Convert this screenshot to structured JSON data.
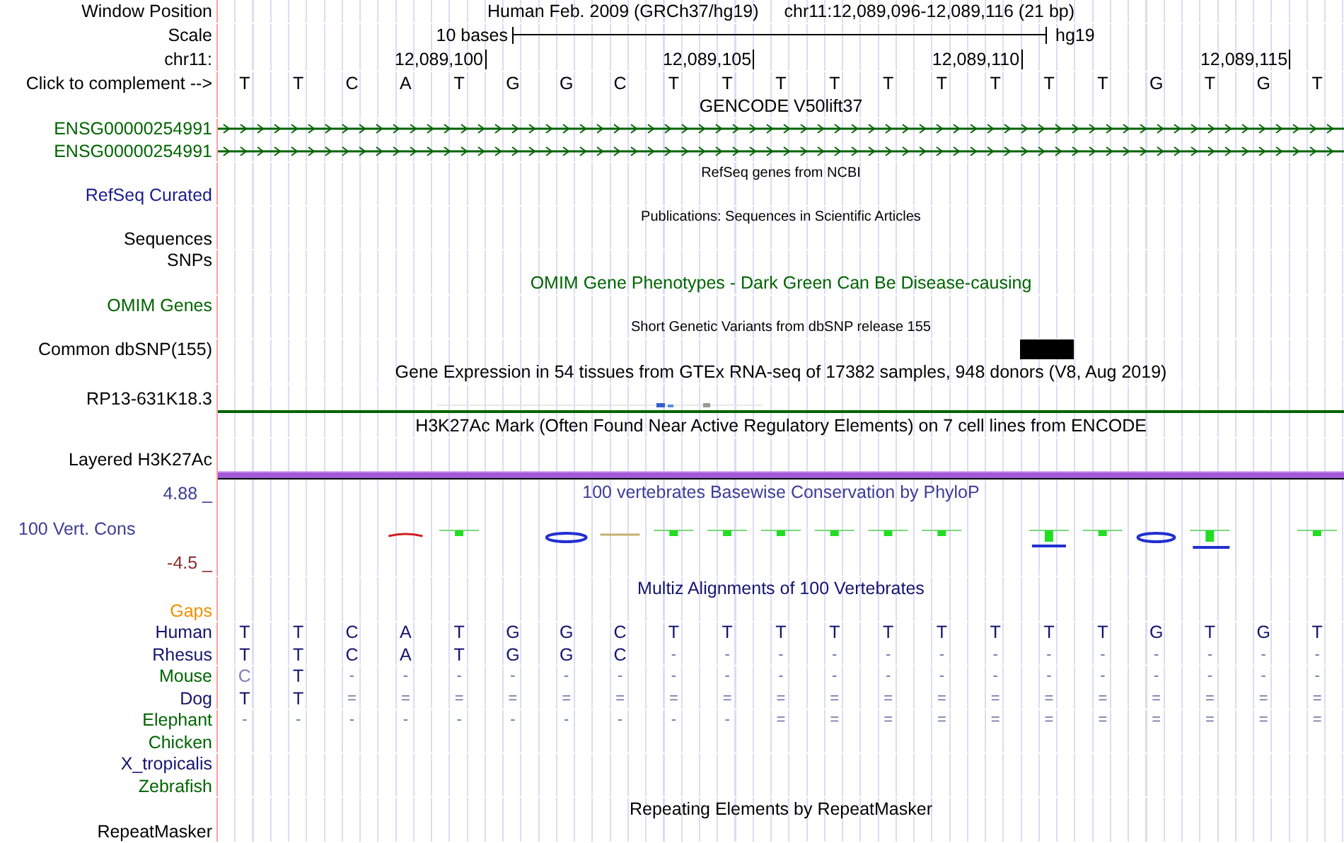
{
  "header": {
    "label": "Window Position",
    "assembly": "Human Feb. 2009 (GRCh37/hg19)",
    "position": "chr11:12,089,096-12,089,116 (21 bp)"
  },
  "scale": {
    "label": "Scale",
    "length": "10 bases",
    "assembly": "hg19"
  },
  "ruler": {
    "label": "chr11:",
    "ticks": [
      "12,089,100",
      "12,089,105",
      "12,089,110",
      "12,089,115"
    ]
  },
  "sequence": {
    "label": "Click to complement -->",
    "bases": [
      "T",
      "T",
      "C",
      "A",
      "T",
      "G",
      "G",
      "C",
      "T",
      "T",
      "T",
      "T",
      "T",
      "T",
      "T",
      "T",
      "T",
      "G",
      "T",
      "G",
      "T"
    ]
  },
  "rows": [
    {
      "kind": "title",
      "text": "GENCODE V50lift37",
      "color": "#000000"
    },
    {
      "kind": "gene",
      "label": "ENSG00000254991",
      "color": "#006400"
    },
    {
      "kind": "gene",
      "label": "ENSG00000254991",
      "color": "#006400"
    },
    {
      "kind": "caption",
      "text": "RefSeq genes from NCBI"
    },
    {
      "kind": "label",
      "label": "RefSeq Curated",
      "color": "#1a1a8c"
    },
    {
      "kind": "caption",
      "text": "Publications: Sequences in Scientific Articles"
    },
    {
      "kind": "label",
      "label": "Sequences",
      "color": "#000000"
    },
    {
      "kind": "label",
      "label": "SNPs",
      "color": "#000000"
    },
    {
      "kind": "title",
      "text": "OMIM Gene Phenotypes - Dark Green Can Be Disease-causing",
      "color": "#006400"
    },
    {
      "kind": "label",
      "label": "OMIM Genes",
      "color": "#006400"
    },
    {
      "kind": "caption",
      "text": "Short Genetic Variants from dbSNP release 155"
    },
    {
      "kind": "variant",
      "label": "Common dbSNP(155)",
      "color": "#000000"
    },
    {
      "kind": "title",
      "text": "Gene Expression in 54 tissues from GTEx RNA-seq of 17382 samples, 948 donors (V8, Aug 2019)",
      "color": "#000000"
    },
    {
      "kind": "expression",
      "label": "RP13-631K18.3",
      "color": "#000000"
    },
    {
      "kind": "title",
      "text": "H3K27Ac Mark (Often Found Near Active Regulatory Elements) on 7 cell lines from ENCODE",
      "color": "#000000"
    },
    {
      "kind": "signal",
      "label": "Layered H3K27Ac",
      "color": "#000000"
    },
    {
      "kind": "conservation",
      "label": "100 Vert. Cons",
      "color": "#3c3c96",
      "max": "4.88 _",
      "min": "-4.5 _",
      "title": "100 vertebrates Basewise Conservation by PhyloP"
    },
    {
      "kind": "title",
      "text": "Multiz Alignments of 100 Vertebrates",
      "color": "#14146e"
    },
    {
      "kind": "label",
      "label": "Gaps",
      "color": "#f09000"
    },
    {
      "kind": "alignment",
      "label": "Human",
      "color": "#14146e",
      "bases": [
        "T",
        "T",
        "C",
        "A",
        "T",
        "G",
        "G",
        "C",
        "T",
        "T",
        "T",
        "T",
        "T",
        "T",
        "T",
        "T",
        "T",
        "G",
        "T",
        "G",
        "T"
      ]
    },
    {
      "kind": "alignment",
      "label": "Rhesus",
      "color": "#14146e",
      "bases": [
        "T",
        "T",
        "C",
        "A",
        "T",
        "G",
        "G",
        "C",
        "-",
        "-",
        "-",
        "-",
        "-",
        "-",
        "-",
        "-",
        "-",
        "-",
        "-",
        "-",
        "-"
      ]
    },
    {
      "kind": "alignment",
      "label": "Mouse",
      "color": "#006400",
      "bases": [
        "C",
        "T",
        "-",
        "-",
        "-",
        "-",
        "-",
        "-",
        "-",
        "-",
        "-",
        "-",
        "-",
        "-",
        "-",
        "-",
        "-",
        "-",
        "-",
        "-",
        "-"
      ],
      "faded": [
        true,
        false,
        false,
        false,
        false,
        false,
        false,
        false,
        false,
        false,
        false,
        false,
        false,
        false,
        false,
        false,
        false,
        false,
        false,
        false,
        false
      ]
    },
    {
      "kind": "alignment",
      "label": "Dog",
      "color": "#14146e",
      "bases": [
        "T",
        "T",
        "=",
        "=",
        "=",
        "=",
        "=",
        "=",
        "=",
        "=",
        "=",
        "=",
        "=",
        "=",
        "=",
        "=",
        "=",
        "=",
        "=",
        "=",
        "="
      ]
    },
    {
      "kind": "alignment",
      "label": "Elephant",
      "color": "#006400",
      "bases": [
        "-",
        "-",
        "-",
        "-",
        "-",
        "-",
        "-",
        "-",
        "-",
        "-",
        "=",
        "=",
        "=",
        "=",
        "=",
        "=",
        "=",
        "=",
        "=",
        "=",
        "="
      ]
    },
    {
      "kind": "label",
      "label": "Chicken",
      "color": "#006400"
    },
    {
      "kind": "label",
      "label": "X_tropicalis",
      "color": "#14146e"
    },
    {
      "kind": "label",
      "label": "Zebrafish",
      "color": "#006400"
    },
    {
      "kind": "title",
      "text": "Repeating Elements by RepeatMasker",
      "color": "#000000"
    },
    {
      "kind": "label",
      "label": "RepeatMasker",
      "color": "#000000"
    }
  ]
}
